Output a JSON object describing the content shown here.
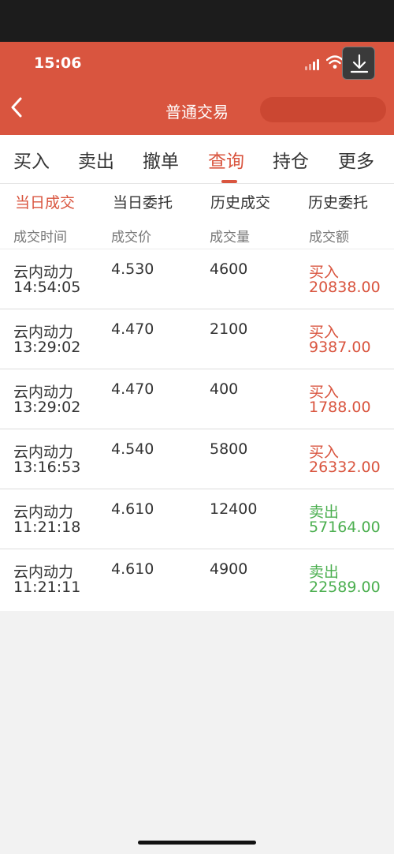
{
  "status_bar": {
    "time": "15:06"
  },
  "nav": {
    "title": "普通交易"
  },
  "tabs": [
    "买入",
    "卖出",
    "撤单",
    "查询",
    "持仓",
    "更多"
  ],
  "subtabs": [
    "当日成交",
    "当日委托",
    "历史成交",
    "历史委托"
  ],
  "columns": [
    "成交时间",
    "成交价",
    "成交量",
    "成交额"
  ],
  "trades": [
    {
      "name": "云内动力",
      "time": "14:54:05",
      "price": "4.530",
      "qty": "4600",
      "dir": "买入",
      "amount": "20838.00"
    },
    {
      "name": "云内动力",
      "time": "13:29:02",
      "price": "4.470",
      "qty": "2100",
      "dir": "买入",
      "amount": "9387.00"
    },
    {
      "name": "云内动力",
      "time": "13:29:02",
      "price": "4.470",
      "qty": "400",
      "dir": "买入",
      "amount": "1788.00"
    },
    {
      "name": "云内动力",
      "time": "13:16:53",
      "price": "4.540",
      "qty": "5800",
      "dir": "买入",
      "amount": "26332.00"
    },
    {
      "name": "云内动力",
      "time": "11:21:18",
      "price": "4.610",
      "qty": "12400",
      "dir": "卖出",
      "amount": "57164.00"
    },
    {
      "name": "云内动力",
      "time": "11:21:11",
      "price": "4.610",
      "qty": "4900",
      "dir": "卖出",
      "amount": "22589.00"
    }
  ],
  "colors": {
    "accent": "#d9553f",
    "buy": "#d9553f",
    "sell": "#4caf50"
  }
}
